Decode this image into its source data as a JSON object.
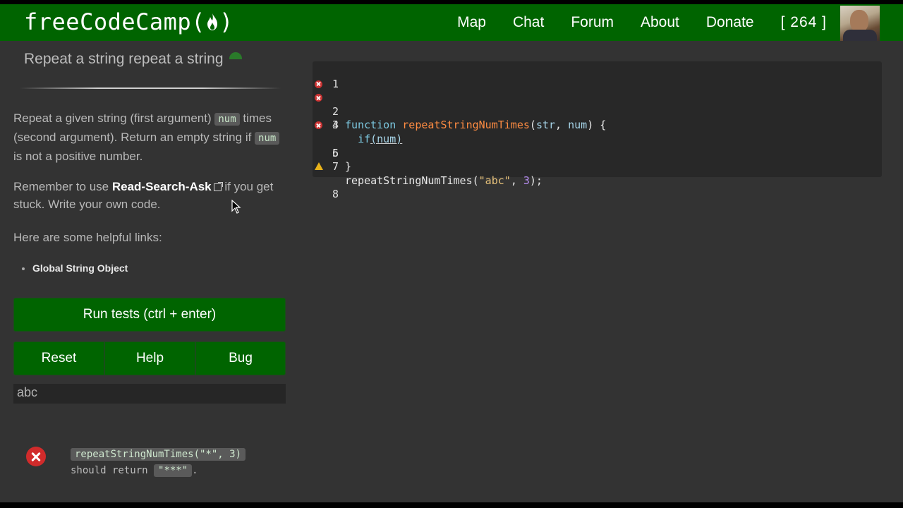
{
  "header": {
    "logo_text": "freeCodeCamp(",
    "logo_close": ")",
    "nav": [
      "Map",
      "Chat",
      "Forum",
      "About",
      "Donate"
    ],
    "points": "[ 264 ]"
  },
  "challenge": {
    "title": "Repeat a string repeat a string",
    "desc_1a": "Repeat a given string (first argument) ",
    "desc_1_code1": "num",
    "desc_1b": " times (second argument). Return an empty string if ",
    "desc_1_code2": "num",
    "desc_1c": " is not a positive number.",
    "desc_2a": "Remember to use ",
    "desc_2_link": "Read-Search-Ask",
    "desc_2b": " if you get stuck. Write your own code.",
    "desc_3": "Here are some helpful links:",
    "links": [
      "Global String Object"
    ]
  },
  "buttons": {
    "run": "Run tests (ctrl + enter)",
    "reset": "Reset",
    "help": "Help",
    "bug": "Bug"
  },
  "output": "abc",
  "test": {
    "code": "repeatStringNumTimes(\"*\", 3)",
    "should_return": "should return",
    "expected": "\"***\"",
    "period": "."
  },
  "editor": {
    "line_numbers": [
      "1",
      "2",
      "3",
      "4",
      "5",
      "6",
      "7",
      "8"
    ],
    "line2": {
      "kw": "function",
      "fn": "repeatStringNumTimes",
      "open": "(",
      "p1": "str",
      "comma": ", ",
      "p2": "num",
      "close": ") {"
    },
    "line3": {
      "indent": "  ",
      "kw": "if",
      "rest": "(num)"
    },
    "line5": "}",
    "line7": {
      "fn": "repeatStringNumTimes",
      "open": "(",
      "str": "\"abc\"",
      "comma": ", ",
      "num": "3",
      "close": ");"
    }
  },
  "colors": {
    "brand_green": "#006400",
    "background": "#333333",
    "error_red": "#d12b2b",
    "warning_yellow": "#e8b21a"
  }
}
